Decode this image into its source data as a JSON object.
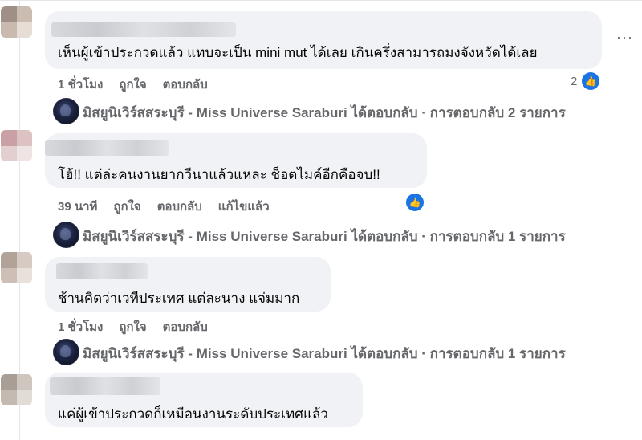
{
  "comments": [
    {
      "text": "เห็นผู้เข้าประกวดแล้ว แทบจะเป็น mini mut ได้เลย เกินครึ่งสามารถมงจังหวัดได้เลย",
      "time": "1 ชั่วโมง",
      "like": "ถูกใจ",
      "reply": "ตอบกลับ",
      "reaction_count": "2",
      "reply_summary": "มิสยูนิเวิร์สสระบุรี - Miss Universe Saraburi ได้ตอบกลับ · การตอบกลับ 2 รายการ"
    },
    {
      "text": "โฮ้!! แต่ล่ะคนงานยากวีนาแล้วแหละ ช็อตไมค์อีกคือจบ!!",
      "time": "39 นาที",
      "like": "ถูกใจ",
      "reply": "ตอบกลับ",
      "edited": "แก้ไขแล้ว",
      "reply_summary": "มิสยูนิเวิร์สสระบุรี - Miss Universe Saraburi ได้ตอบกลับ · การตอบกลับ 1 รายการ"
    },
    {
      "text": "ช้านคิดว่าเวทีประเทศ แต่ละนาง แจ่มมาก",
      "time": "1 ชั่วโมง",
      "like": "ถูกใจ",
      "reply": "ตอบกลับ",
      "reply_summary": "มิสยูนิเวิร์สสระบุรี - Miss Universe Saraburi ได้ตอบกลับ · การตอบกลับ 1 รายการ"
    },
    {
      "text": "แค่ผู้เข้าประกวดก็เหมือนงานระดับประเทศแล้ว"
    }
  ],
  "more_icon": "···",
  "like_icon": "👍",
  "colors": {
    "bubble": "#f0f2f5",
    "secondary_text": "#65676b",
    "accent": "#1b74e4"
  }
}
